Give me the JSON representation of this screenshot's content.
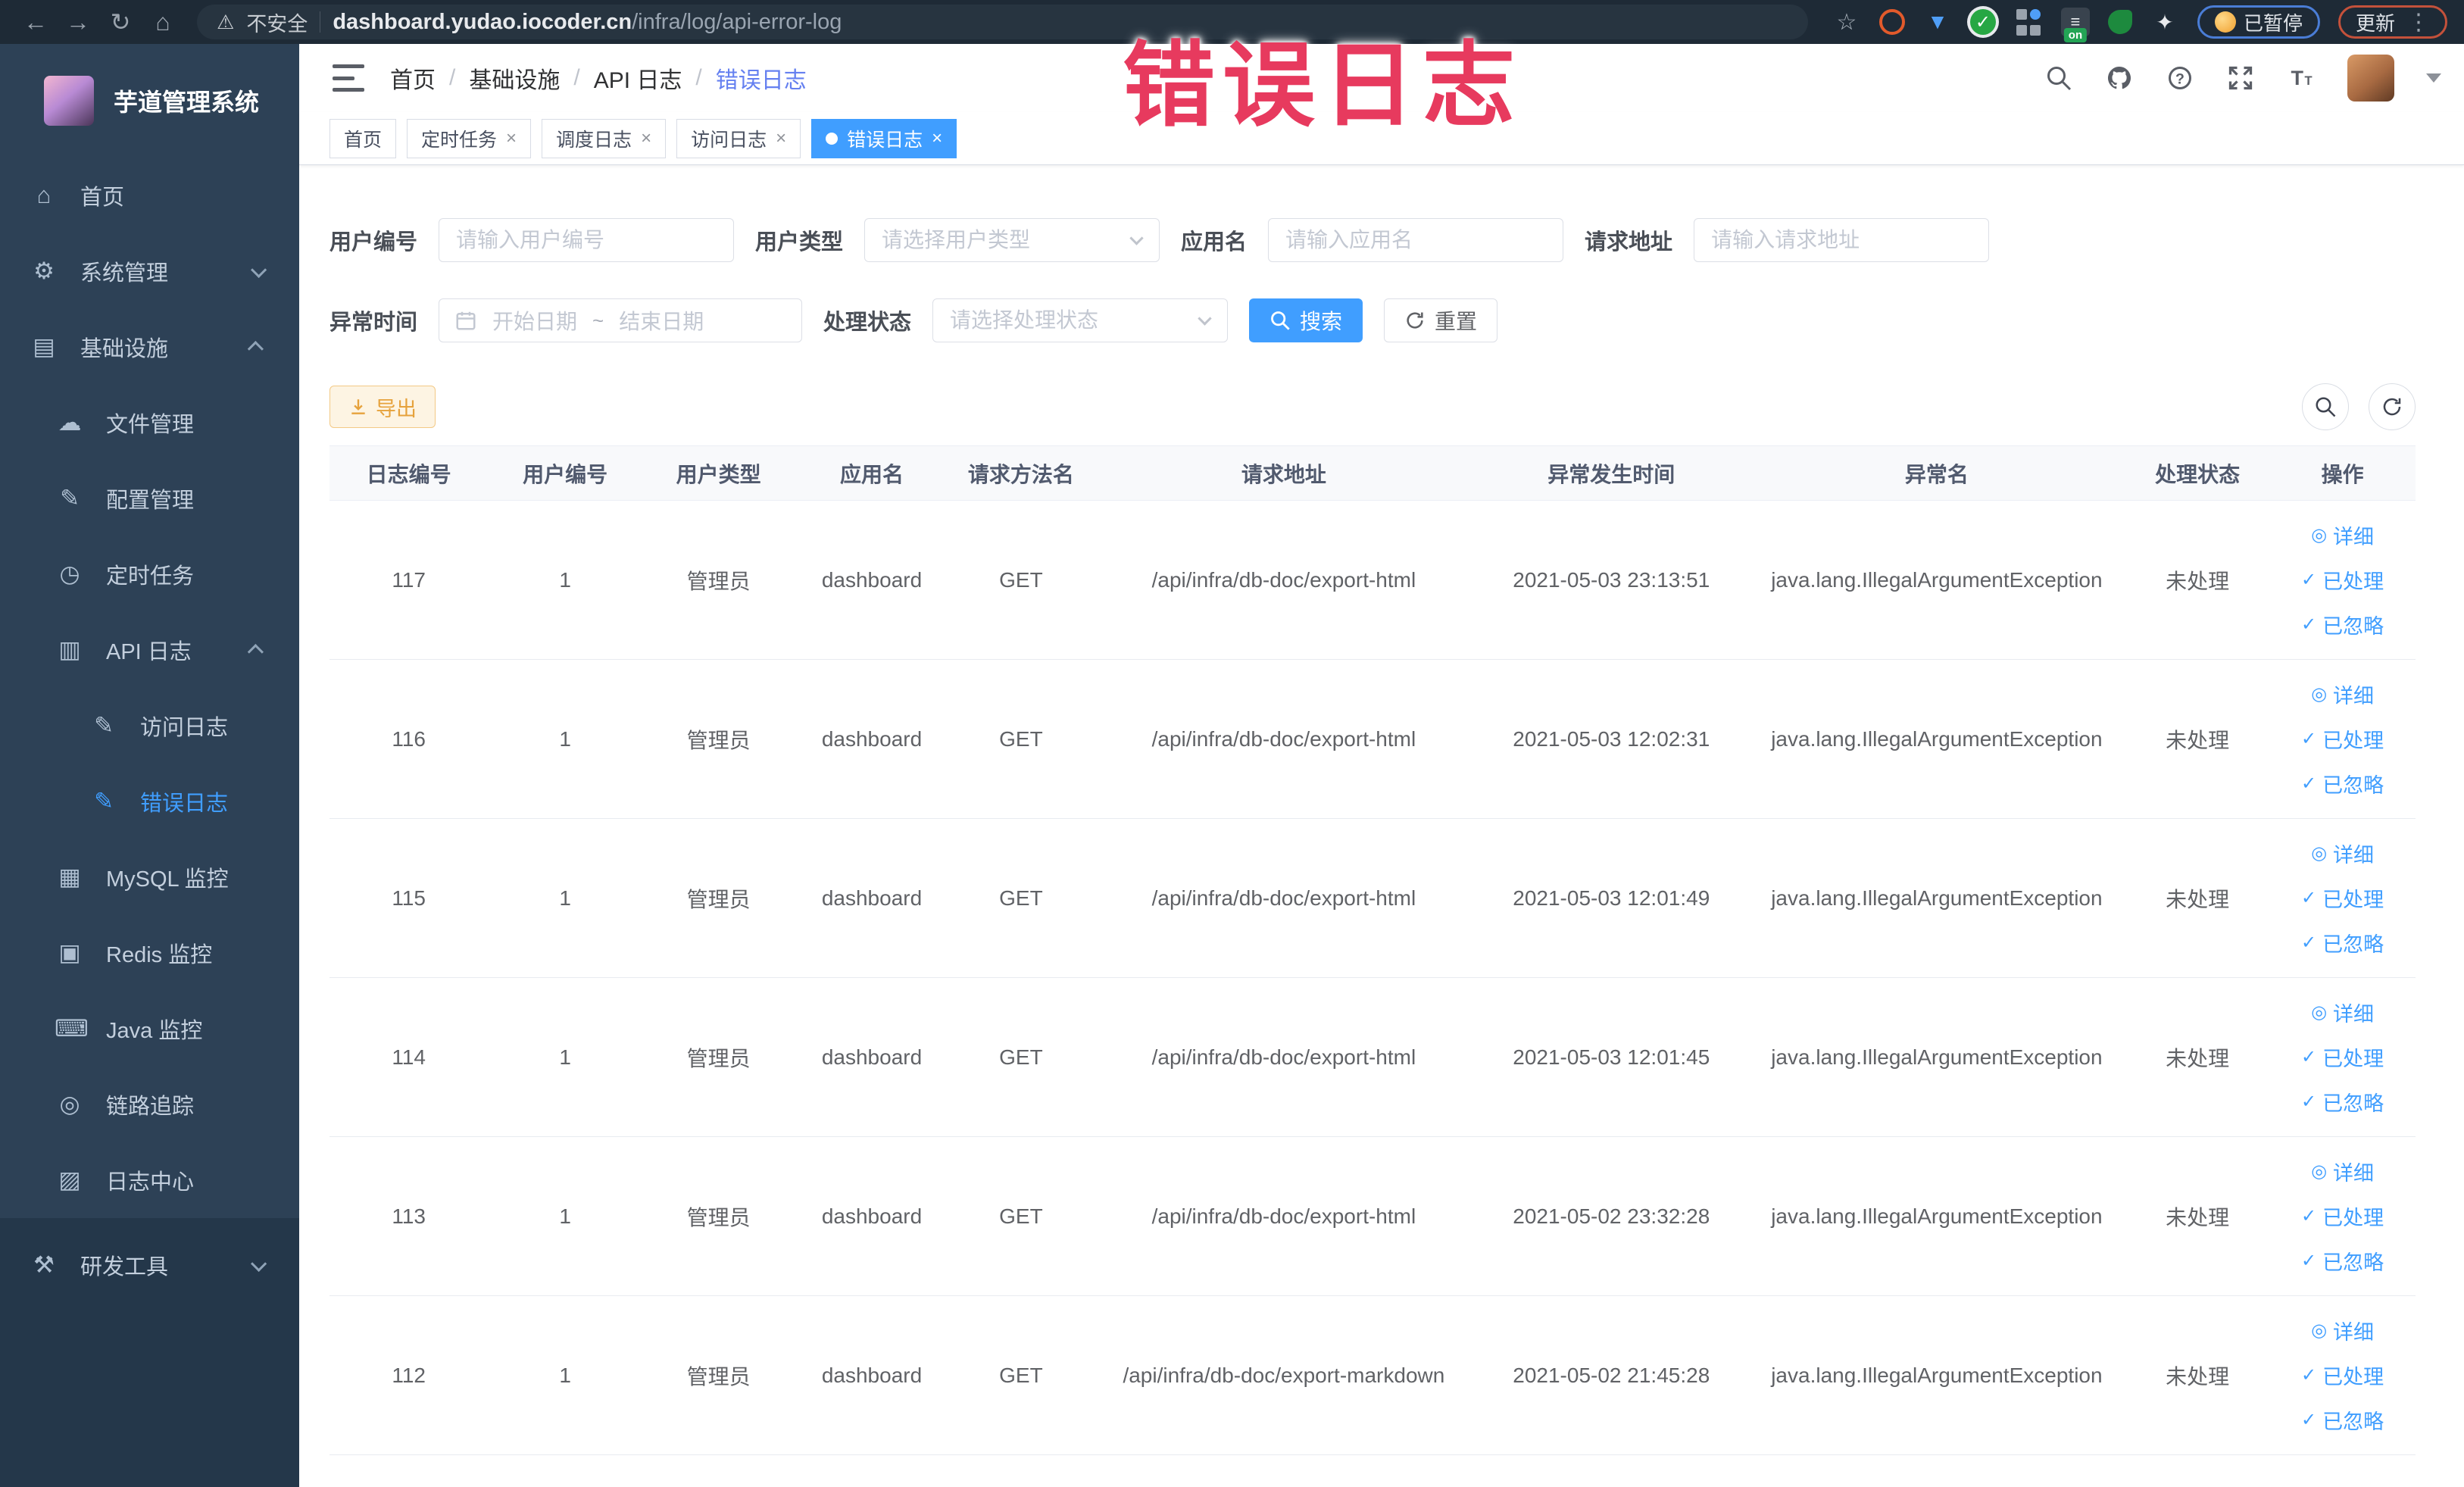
{
  "browser": {
    "security_label": "不安全",
    "url_host": "dashboard.yudao.iocoder.cn",
    "url_path": "/infra/log/api-error-log",
    "extension_on_badge": "on",
    "paused_pill": "已暂停",
    "update_button": "更新"
  },
  "annotation": {
    "text": "错误日志",
    "color": "#e73a5e"
  },
  "sidebar": {
    "title": "芋道管理系统",
    "items": [
      {
        "key": "home",
        "label": "首页",
        "icon": "home-icon",
        "level": 0
      },
      {
        "key": "system-mgmt",
        "label": "系统管理",
        "icon": "gear-icon",
        "level": 0,
        "chevron": "down"
      },
      {
        "key": "infrastructure",
        "label": "基础设施",
        "icon": "infra-icon",
        "level": 0,
        "chevron": "up"
      },
      {
        "key": "file-mgmt",
        "label": "文件管理",
        "icon": "cloud-icon",
        "level": 1
      },
      {
        "key": "config-mgmt",
        "label": "配置管理",
        "icon": "edit-icon",
        "level": 1
      },
      {
        "key": "scheduled-jobs",
        "label": "定时任务",
        "icon": "clock-icon",
        "level": 1
      },
      {
        "key": "api-log",
        "label": "API 日志",
        "icon": "api-log-icon",
        "level": 1,
        "chevron": "up"
      },
      {
        "key": "access-log",
        "label": "访问日志",
        "icon": "access-log-icon",
        "level": 2
      },
      {
        "key": "error-log",
        "label": "错误日志",
        "icon": "error-log-icon",
        "level": 2,
        "active": true
      },
      {
        "key": "mysql-monitor",
        "label": "MySQL 监控",
        "icon": "mysql-icon",
        "level": 1
      },
      {
        "key": "redis-monitor",
        "label": "Redis 监控",
        "icon": "redis-icon",
        "level": 1
      },
      {
        "key": "java-monitor",
        "label": "Java 监控",
        "icon": "java-icon",
        "level": 1
      },
      {
        "key": "trace",
        "label": "链路追踪",
        "icon": "trace-icon",
        "level": 1
      },
      {
        "key": "log-center",
        "label": "日志中心",
        "icon": "log-center-icon",
        "level": 1
      },
      {
        "key": "dev-tools",
        "label": "研发工具",
        "icon": "tools-icon",
        "level": 0,
        "chevron": "down",
        "section": "dark"
      }
    ]
  },
  "header": {
    "breadcrumb": [
      {
        "label": "首页",
        "current": false
      },
      {
        "label": "基础设施",
        "current": false
      },
      {
        "label": "API 日志",
        "current": false
      },
      {
        "label": "错误日志",
        "current": true
      }
    ]
  },
  "tabs": [
    {
      "key": "home",
      "label": "首页",
      "closable": false,
      "active": false
    },
    {
      "key": "job",
      "label": "定时任务",
      "closable": true,
      "active": false
    },
    {
      "key": "job-log",
      "label": "调度日志",
      "closable": true,
      "active": false
    },
    {
      "key": "access-log",
      "label": "访问日志",
      "closable": true,
      "active": false
    },
    {
      "key": "error-log",
      "label": "错误日志",
      "closable": true,
      "active": true
    }
  ],
  "filters": {
    "user_id": {
      "label": "用户编号",
      "placeholder": "请输入用户编号"
    },
    "user_type": {
      "label": "用户类型",
      "placeholder": "请选择用户类型"
    },
    "app_name": {
      "label": "应用名",
      "placeholder": "请输入应用名"
    },
    "request_url": {
      "label": "请求地址",
      "placeholder": "请输入请求地址"
    },
    "exception_time": {
      "label": "异常时间",
      "start_placeholder": "开始日期",
      "separator": "~",
      "end_placeholder": "结束日期"
    },
    "process_status": {
      "label": "处理状态",
      "placeholder": "请选择处理状态"
    },
    "search_button": "搜索",
    "reset_button": "重置"
  },
  "toolbar": {
    "export_button": "导出"
  },
  "table": {
    "columns": [
      "日志编号",
      "用户编号",
      "用户类型",
      "应用名",
      "请求方法名",
      "请求地址",
      "异常发生时间",
      "异常名",
      "处理状态",
      "操作"
    ],
    "action_labels": [
      "详细",
      "已处理",
      "已忽略"
    ],
    "rows": [
      {
        "log_id": "117",
        "user_id": "1",
        "user_type": "管理员",
        "app_name": "dashboard",
        "method": "GET",
        "url": "/api/infra/db-doc/export-html",
        "time": "2021-05-03 23:13:51",
        "exception": "java.lang.IllegalArgumentException",
        "status": "未处理"
      },
      {
        "log_id": "116",
        "user_id": "1",
        "user_type": "管理员",
        "app_name": "dashboard",
        "method": "GET",
        "url": "/api/infra/db-doc/export-html",
        "time": "2021-05-03 12:02:31",
        "exception": "java.lang.IllegalArgumentException",
        "status": "未处理"
      },
      {
        "log_id": "115",
        "user_id": "1",
        "user_type": "管理员",
        "app_name": "dashboard",
        "method": "GET",
        "url": "/api/infra/db-doc/export-html",
        "time": "2021-05-03 12:01:49",
        "exception": "java.lang.IllegalArgumentException",
        "status": "未处理"
      },
      {
        "log_id": "114",
        "user_id": "1",
        "user_type": "管理员",
        "app_name": "dashboard",
        "method": "GET",
        "url": "/api/infra/db-doc/export-html",
        "time": "2021-05-03 12:01:45",
        "exception": "java.lang.IllegalArgumentException",
        "status": "未处理"
      },
      {
        "log_id": "113",
        "user_id": "1",
        "user_type": "管理员",
        "app_name": "dashboard",
        "method": "GET",
        "url": "/api/infra/db-doc/export-html",
        "time": "2021-05-02 23:32:28",
        "exception": "java.lang.IllegalArgumentException",
        "status": "未处理"
      },
      {
        "log_id": "112",
        "user_id": "1",
        "user_type": "管理员",
        "app_name": "dashboard",
        "method": "GET",
        "url": "/api/infra/db-doc/export-markdown",
        "time": "2021-05-02 21:45:28",
        "exception": "java.lang.IllegalArgumentException",
        "status": "未处理"
      }
    ]
  },
  "colors": {
    "accent": "#409eff",
    "warning": "#e6a23c",
    "sidebar_bg": "#2d4156",
    "chrome_bg": "#1e2a36",
    "annotation": "#e73a5e"
  }
}
